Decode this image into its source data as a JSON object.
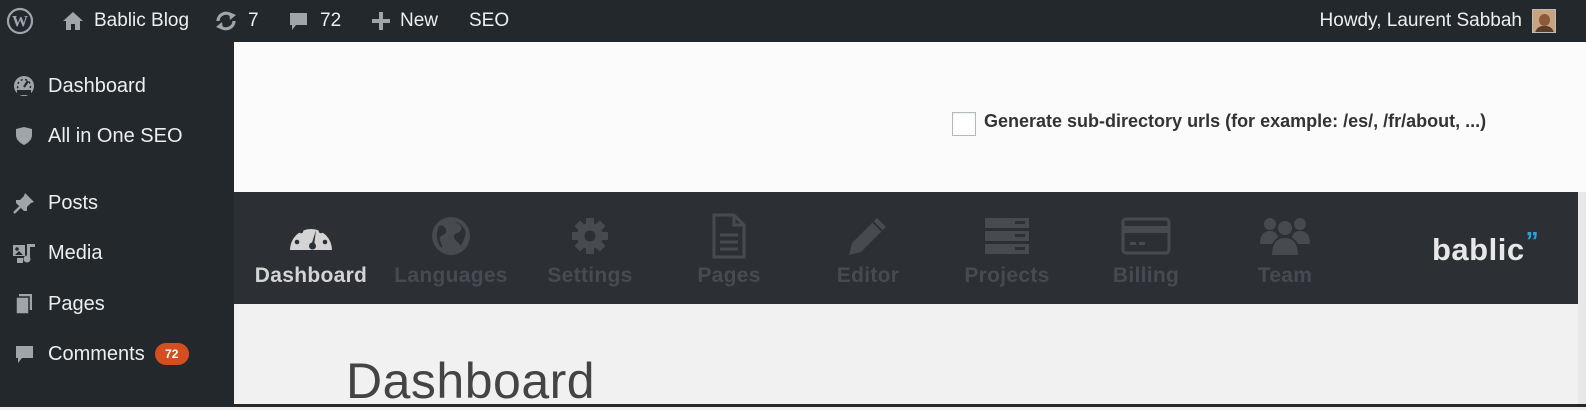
{
  "adminbar": {
    "site_name": "Bablic Blog",
    "updates_count": "7",
    "comments_count": "72",
    "new_label": "New",
    "seo_label": "SEO",
    "howdy": "Howdy, Laurent Sabbah",
    "icons": [
      "wordpress-icon",
      "home-icon",
      "updates-icon",
      "comment-icon",
      "plus-icon"
    ]
  },
  "sidebar": {
    "items": [
      {
        "label": "Dashboard",
        "icon": "dashboard-icon"
      },
      {
        "label": "All in One SEO",
        "icon": "shield-icon"
      },
      {
        "label": "Posts",
        "icon": "pin-icon"
      },
      {
        "label": "Media",
        "icon": "media-icon"
      },
      {
        "label": "Pages",
        "icon": "pages-icon"
      },
      {
        "label": "Comments",
        "icon": "comment-icon",
        "badge": "72"
      }
    ]
  },
  "settings": {
    "subdir_label": "Generate sub-directory urls (for example: /es/, /fr/about, ...)"
  },
  "bablic_nav": {
    "items": [
      {
        "label": "Dashboard",
        "icon": "gauge-icon",
        "active": true
      },
      {
        "label": "Languages",
        "icon": "globe-icon",
        "active": false
      },
      {
        "label": "Settings",
        "icon": "gear-icon",
        "active": false
      },
      {
        "label": "Pages",
        "icon": "document-icon",
        "active": false
      },
      {
        "label": "Editor",
        "icon": "pencil-icon",
        "active": false
      },
      {
        "label": "Projects",
        "icon": "server-icon",
        "active": false
      },
      {
        "label": "Billing",
        "icon": "credit-card-icon",
        "active": false
      },
      {
        "label": "Team",
        "icon": "team-icon",
        "active": false
      }
    ],
    "brand": "bablic",
    "brand_mark": "”"
  },
  "main": {
    "title": "Dashboard"
  },
  "colors": {
    "adminbar_bg": "#23282d",
    "nav_bg": "#2c3035",
    "badge": "#d54e21",
    "brand_accent": "#2aa3d8"
  }
}
